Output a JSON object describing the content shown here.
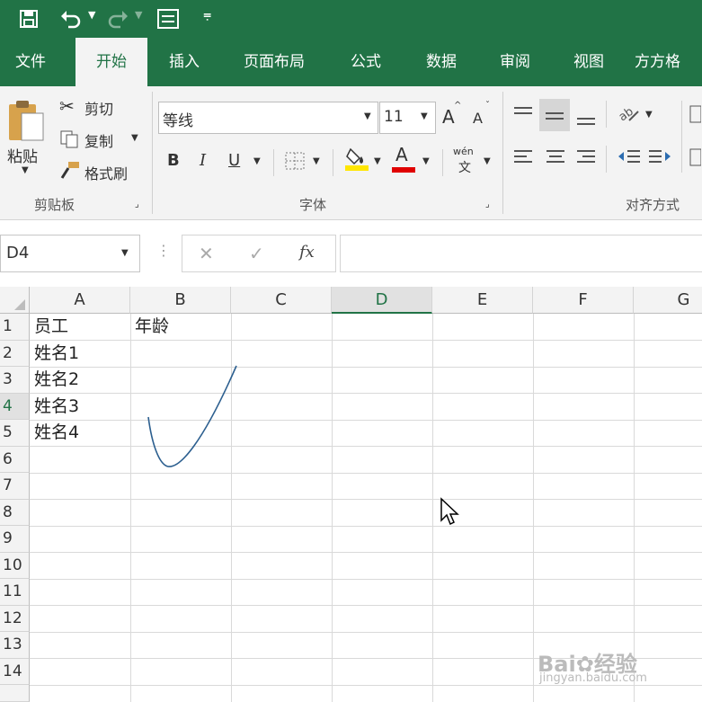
{
  "colors": {
    "brand": "#217346",
    "ribbon": "#f3f3f3",
    "font_color_bar": "#e00000",
    "highlight_bar": "#ffe600",
    "ink": "#2c5f8f"
  },
  "quick_access": {
    "save_icon": "save-icon",
    "undo_icon": "undo-icon",
    "redo_icon": "redo-icon",
    "form_icon": "form-icon",
    "customize_icon": "customize-icon"
  },
  "tabs": [
    "文件",
    "开始",
    "插入",
    "页面布局",
    "公式",
    "数据",
    "审阅",
    "视图",
    "方方格"
  ],
  "ribbon": {
    "clipboard": {
      "paste": "粘贴",
      "cut": "剪切",
      "copy": "复制",
      "format_painter": "格式刷",
      "group": "剪贴板"
    },
    "font": {
      "name": "等线",
      "size": "11",
      "grow": "A",
      "shrink": "A",
      "bold": "B",
      "italic": "I",
      "underline": "U",
      "color_letter": "A",
      "phonetic_top": "wén",
      "phonetic_bottom": "文",
      "group": "字体"
    },
    "alignment": {
      "group": "对齐方式"
    }
  },
  "formula_bar": {
    "name_box": "D4",
    "cancel": "✕",
    "enter": "✓",
    "fx": "fx",
    "formula": ""
  },
  "columns": [
    "A",
    "B",
    "C",
    "D",
    "E",
    "F",
    "G"
  ],
  "rows": [
    "1",
    "2",
    "3",
    "4",
    "5",
    "6",
    "7",
    "8",
    "9",
    "10",
    "11",
    "12",
    "13",
    "14"
  ],
  "cells": {
    "A1": "员工",
    "B1": "年龄",
    "A2": "姓名1",
    "A3": "姓名2",
    "A4": "姓名3",
    "A5": "姓名4"
  },
  "watermark": {
    "brand": "Bai",
    "brand2": "经验",
    "url": "jingyan.baidu.com"
  }
}
